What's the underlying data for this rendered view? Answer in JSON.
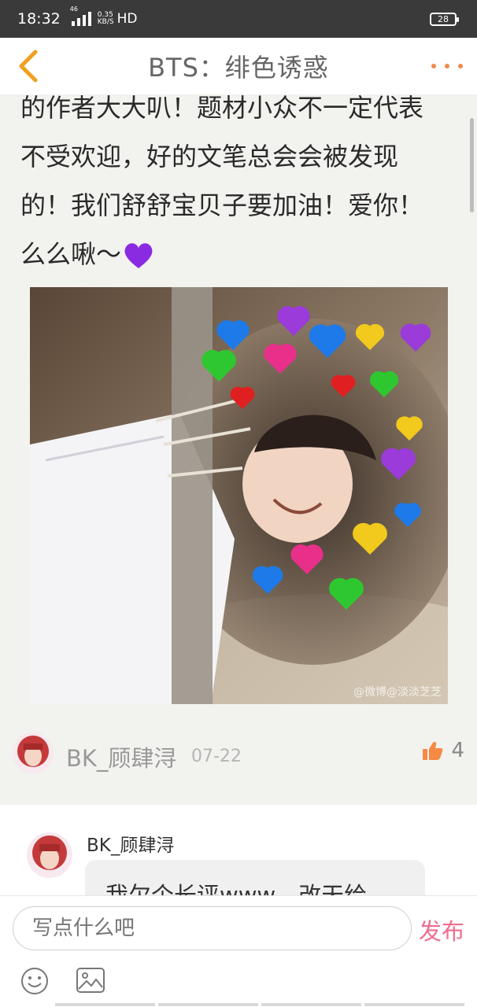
{
  "status_bar": {
    "time": "18:32",
    "network": "46",
    "speed_value": "0.35",
    "speed_unit": "KB/S",
    "hd": "HD",
    "battery": "28"
  },
  "header": {
    "title": "BTS：绯色诱惑",
    "back_icon": "chevron-left-icon",
    "more_icon": "more-dots-icon",
    "accent_color": "#f0a020"
  },
  "post": {
    "lines": [
      "的作者大大叭！题材小众不一定代表",
      "不受欢迎，好的文笔总会会被发现",
      "的！我们舒舒宝贝子要加油！爱你！",
      "么么啾〜"
    ],
    "emoji": "purple-heart-icon",
    "image_watermark": "@微博@淡淡芝芝"
  },
  "reply": {
    "author": "BK_顾肆浔",
    "date": "07-22",
    "likes": "4",
    "like_icon": "thumbs-up-icon"
  },
  "comment": {
    "author": "BK_顾肆浔",
    "text": "我欠个长评www，改天给"
  },
  "bottom_bar": {
    "input_placeholder": "写点什么吧",
    "publish_label": "发布",
    "publish_color": "#ee6d8f",
    "emoji_icon": "smiley-icon",
    "image_icon": "image-icon"
  }
}
